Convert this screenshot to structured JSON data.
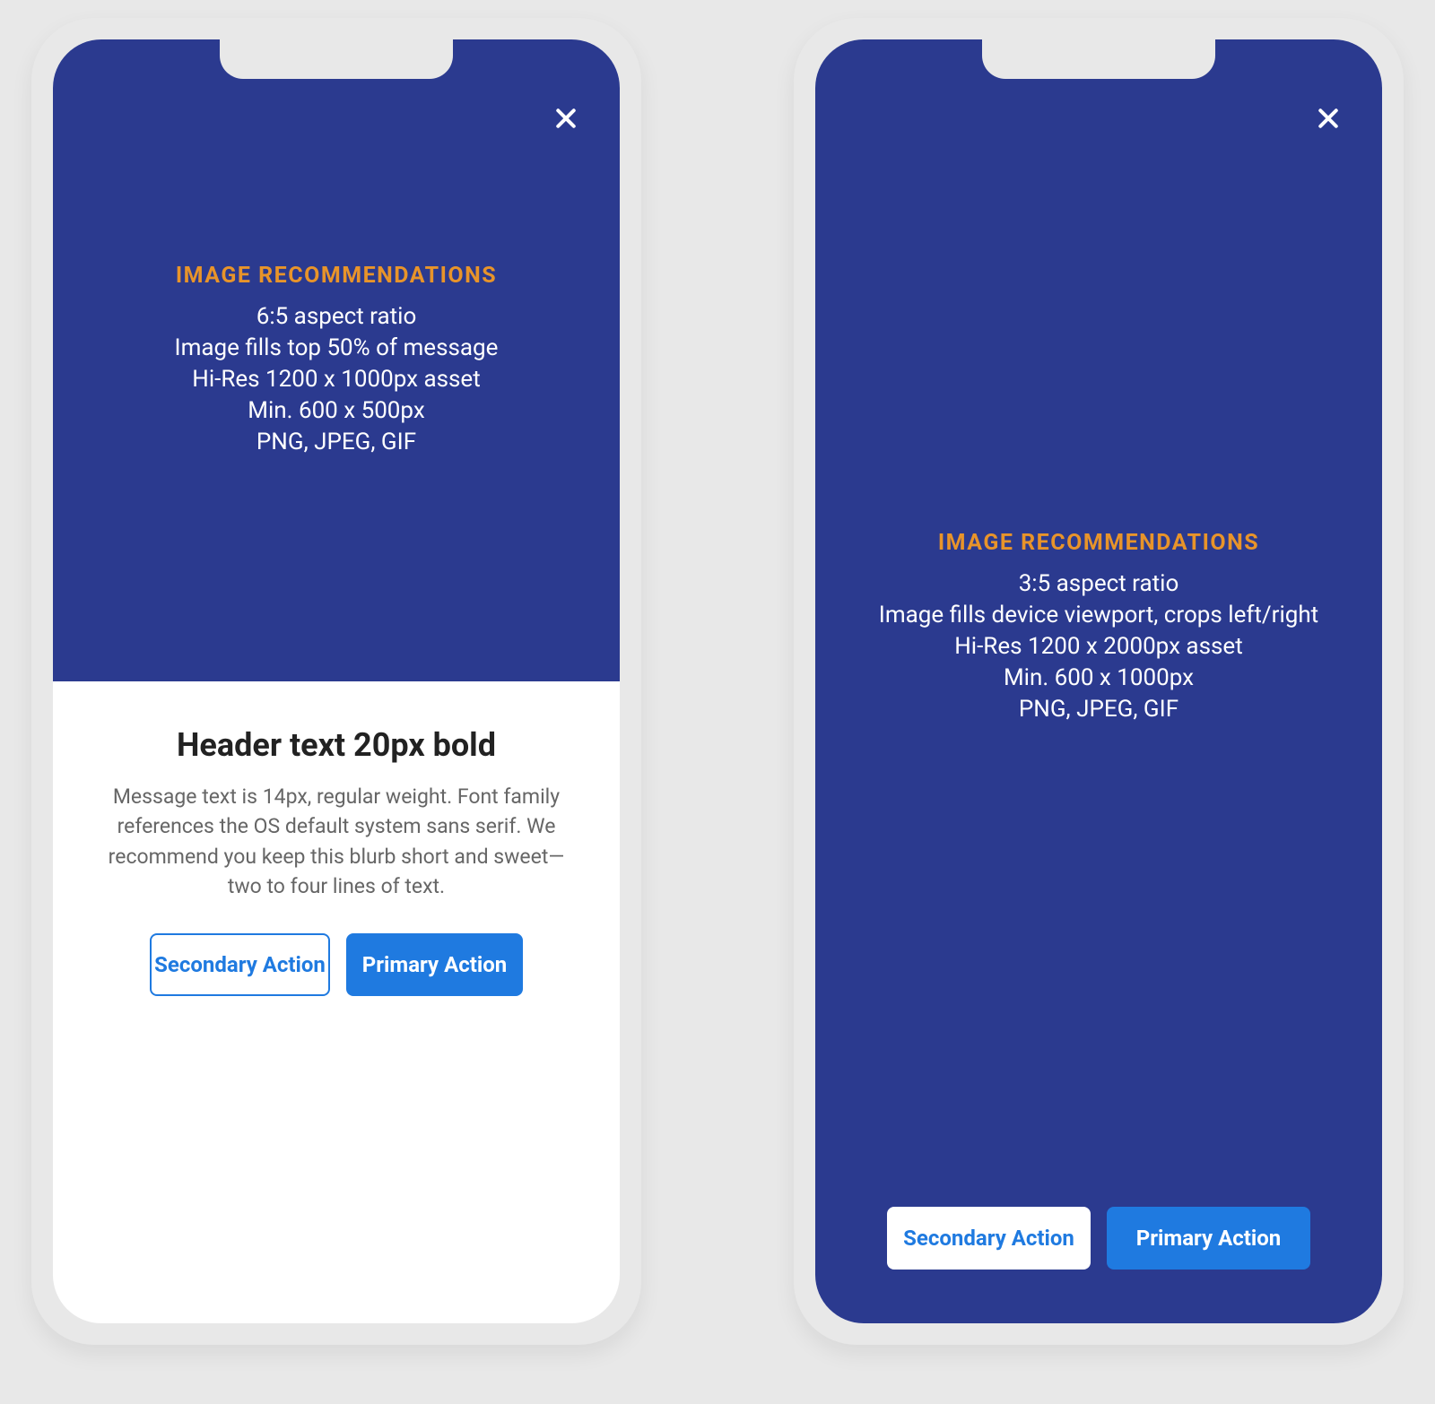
{
  "colors": {
    "image_bg": "#2b3a8f",
    "accent_orange": "#e8942a",
    "button_blue": "#1f7ae0"
  },
  "left": {
    "recs_title": "IMAGE RECOMMENDATIONS",
    "recs": [
      "6:5 aspect ratio",
      "Image fills top 50% of message",
      "Hi-Res 1200 x 1000px asset",
      "Min. 600 x 500px",
      "PNG, JPEG, GIF"
    ],
    "header": "Header text 20px bold",
    "message": "Message text is 14px, regular weight. Font family references the OS default system sans serif. We recommend you keep this blurb short and sweet—two to four lines of text.",
    "secondary_label": "Secondary Action",
    "primary_label": "Primary Action"
  },
  "right": {
    "recs_title": "IMAGE  RECOMMENDATIONS",
    "recs": [
      "3:5 aspect ratio",
      "Image fills device viewport, crops left/right",
      "Hi-Res 1200 x 2000px asset",
      "Min. 600 x 1000px",
      "PNG, JPEG, GIF"
    ],
    "secondary_label": "Secondary Action",
    "primary_label": "Primary Action"
  }
}
